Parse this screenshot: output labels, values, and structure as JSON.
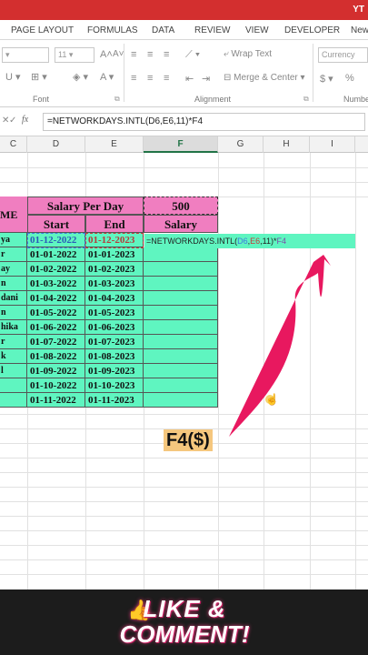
{
  "header": {
    "badge": "YT"
  },
  "tabs": [
    "PAGE LAYOUT",
    "FORMULAS",
    "DATA",
    "REVIEW",
    "VIEW",
    "DEVELOPER",
    "New"
  ],
  "ribbon": {
    "font_size": "11",
    "wrap_text": "Wrap Text",
    "merge_center": "Merge & Center",
    "number_format": "Currency",
    "currency_symbol": "$",
    "percent_symbol": "%",
    "group_font": "Font",
    "group_alignment": "Alignment",
    "group_number": "Numbe"
  },
  "formula_bar": {
    "fx": "fx",
    "formula": "=NETWORKDAYS.INTL(D6,E6,11)*F4"
  },
  "columns": [
    "C",
    "D",
    "E",
    "F",
    "G",
    "H",
    "I"
  ],
  "table": {
    "name_header": "ME",
    "title_label": "Salary Per Day",
    "title_value": "500",
    "col_start": "Start",
    "col_end": "End",
    "col_salary": "Salary",
    "editing_formula": {
      "prefix": "=NETWORKDAYS.INTL(",
      "ref1": "D6",
      "sep1": ",",
      "ref2": "E6",
      "tail": ",11)*",
      "ref3": "F4"
    },
    "rows": [
      {
        "name": "ya",
        "start": "01-12-2022",
        "end": "01-12-2023"
      },
      {
        "name": "r",
        "start": "01-01-2022",
        "end": "01-01-2023"
      },
      {
        "name": "ay",
        "start": "01-02-2022",
        "end": "01-02-2023"
      },
      {
        "name": "n",
        "start": "01-03-2022",
        "end": "01-03-2023"
      },
      {
        "name": "dani",
        "start": "01-04-2022",
        "end": "01-04-2023"
      },
      {
        "name": "n",
        "start": "01-05-2022",
        "end": "01-05-2023"
      },
      {
        "name": "hika",
        "start": "01-06-2022",
        "end": "01-06-2023"
      },
      {
        "name": "r",
        "start": "01-07-2022",
        "end": "01-07-2023"
      },
      {
        "name": "k",
        "start": "01-08-2022",
        "end": "01-08-2023"
      },
      {
        "name": "l",
        "start": "01-09-2022",
        "end": "01-09-2023"
      },
      {
        "name": "",
        "start": "01-10-2022",
        "end": "01-10-2023"
      },
      {
        "name": "",
        "start": "01-11-2022",
        "end": "01-11-2023"
      }
    ]
  },
  "overlay": {
    "hint": "F4($)",
    "cta_line1": "LIKE &",
    "cta_line2": "COMMENT!",
    "arrow_color": "#e8185f",
    "cta_glow_color": "#e03a7a"
  }
}
